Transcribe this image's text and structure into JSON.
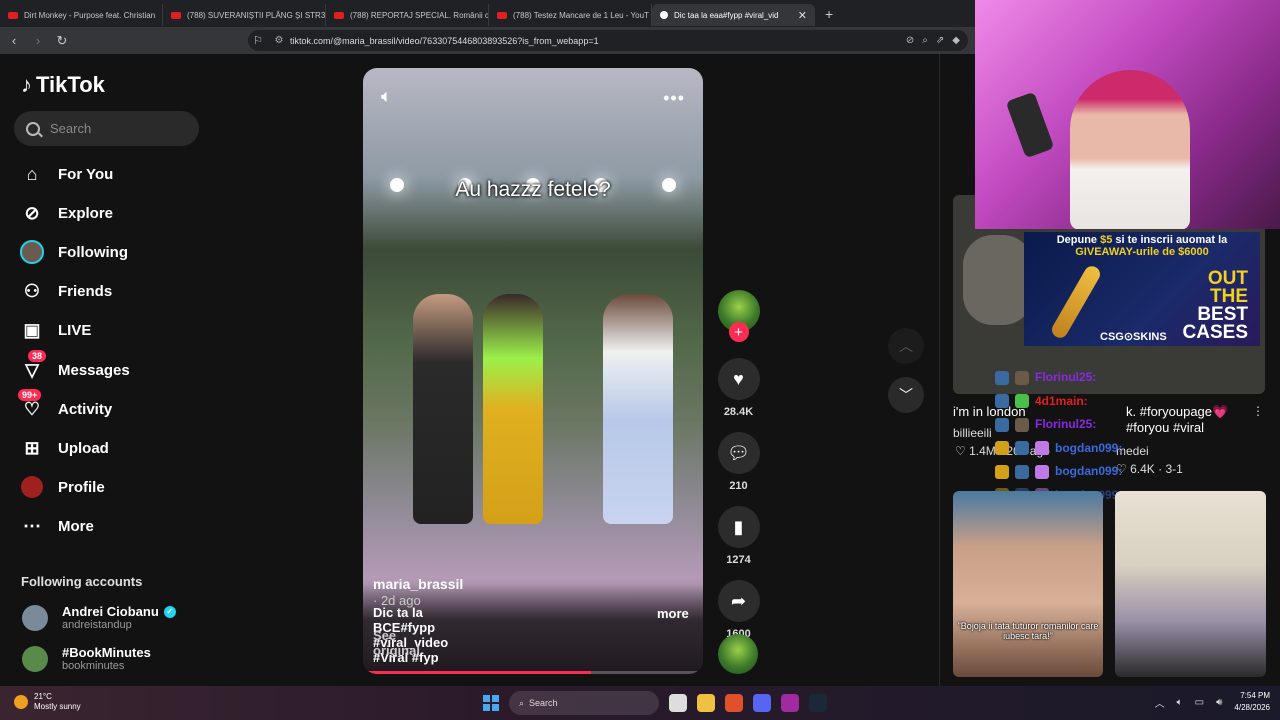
{
  "browser": {
    "tabs": [
      {
        "title": "Dirt Monkey - Purpose feat. Christian",
        "active": false
      },
      {
        "title": "(788) SUVERANIȘTII PLÂNG ȘI STR3S",
        "active": false
      },
      {
        "title": "(788) REPORTAJ SPECIAL. Românii ca",
        "active": false
      },
      {
        "title": "(788) Testez Mancare de 1 Leu - YouT",
        "active": false
      },
      {
        "title": "Dic taa la eaa#fypp #viral_vid",
        "active": true
      }
    ],
    "url": "tiktok.com/@maria_brassil/video/7633075446803893526?is_from_webapp=1"
  },
  "tiktok": {
    "logo_text": "TikTok",
    "search_placeholder": "Search",
    "nav": [
      {
        "label": "For You",
        "icon": "home-icon"
      },
      {
        "label": "Explore",
        "icon": "compass-icon"
      },
      {
        "label": "Following",
        "icon": "following-avatar-icon"
      },
      {
        "label": "Friends",
        "icon": "friends-icon"
      },
      {
        "label": "LIVE",
        "icon": "live-icon"
      },
      {
        "label": "Messages",
        "icon": "messages-icon",
        "badge": "38"
      },
      {
        "label": "Activity",
        "icon": "activity-icon",
        "badge": "99+"
      },
      {
        "label": "Upload",
        "icon": "upload-icon"
      },
      {
        "label": "Profile",
        "icon": "profile-avatar-icon"
      },
      {
        "label": "More",
        "icon": "more-icon"
      }
    ],
    "following_title": "Following accounts",
    "following_accounts": [
      {
        "name": "Andrei Ciobanu",
        "handle": "andreistandup",
        "verified": true
      },
      {
        "name": "#BookMinutes",
        "handle": "bookminutes",
        "verified": false
      }
    ],
    "video": {
      "overlay_text": "Au hazzz fetele?",
      "author": "maria_brassil",
      "ago": "· 2d ago",
      "description": "Dic ta la BCE#fypp #viral_video #Viral #fyp",
      "more_label": "more",
      "see_original": "See original",
      "progress": 0.67
    },
    "actions": {
      "likes": "28.4K",
      "comments": "210",
      "saves": "1274",
      "shares": "1600"
    }
  },
  "stream_overlay": {
    "ad": {
      "line1_a": "Depune ",
      "line1_amount": "$5",
      "line1_b": " si te inscrii auomat la",
      "line2_a": "GIVEAWAY-urile de ",
      "line2_amount": "$6000",
      "big_1": "OUT",
      "big_2": "THE",
      "big_3": "BEST",
      "big_4": "CASES",
      "brand": "CSG⊙SKINS"
    },
    "chat": [
      {
        "user": "Florinul25:",
        "color": "#8a2ae0"
      },
      {
        "user": "4d1main:",
        "color": "#e02020"
      },
      {
        "user": "Florinul25:",
        "color": "#8a2ae0"
      },
      {
        "user": "bogdan099:",
        "color": "#3a6ae0"
      },
      {
        "user": "bogdan099:",
        "color": "#3a6ae0"
      },
      {
        "user": "bogdan099:",
        "color": "#3a6ae0"
      }
    ]
  },
  "recommendations": {
    "item1_caption": "i'm in london",
    "item1_user": "billieeili",
    "item1_stats": "♡ 1.4M · 20h ago",
    "item2_caption": "k. #foryoupage💗",
    "item2_caption2": "#foryou #viral",
    "item2_user": "medei",
    "item2_stats": "♡ 6.4K · 3-1",
    "thumb_a_subtitle": "\"Bojoja ii tata tuturor romanilor care iubesc tara!\""
  },
  "taskbar": {
    "temp": "21°C",
    "weather": "Mostly sunny",
    "search_label": "Search",
    "time": "7:54 PM",
    "date": "4/28/2026"
  }
}
